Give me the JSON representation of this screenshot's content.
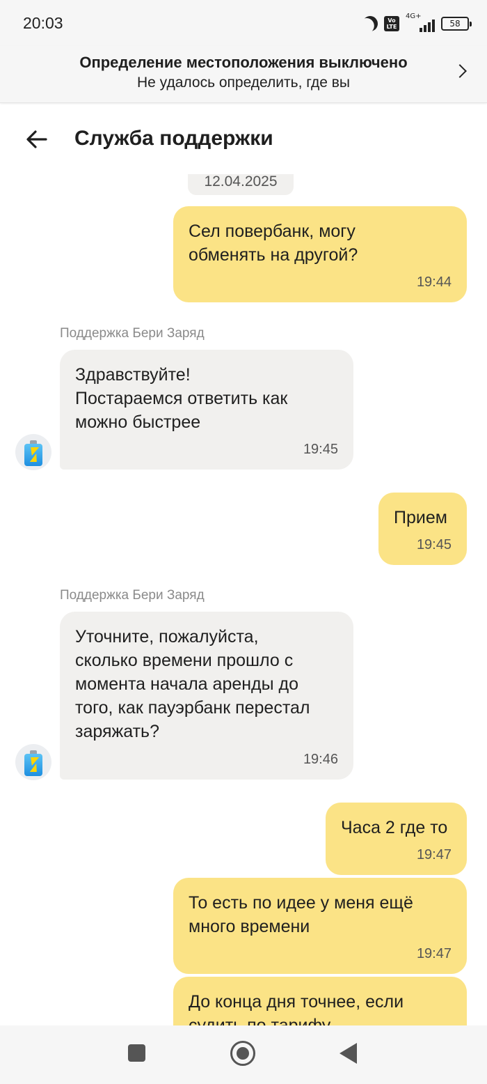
{
  "status_bar": {
    "time": "20:03",
    "volte": "Vo LTE",
    "network": "4G+",
    "battery": "58",
    "icons": [
      "moon-icon",
      "volte-icon",
      "signal-icon",
      "battery-icon"
    ]
  },
  "location_banner": {
    "title": "Определение местоположения выключено",
    "subtitle": "Не удалось определить, где вы"
  },
  "header": {
    "title": "Служба поддержки"
  },
  "chat": {
    "date_label": "12.04.2025",
    "sender_name": "Поддержка Бери Заряд",
    "messages": [
      {
        "direction": "out",
        "text": "Сел повербанк, могу\nобменять на другой?",
        "time": "19:44"
      },
      {
        "direction": "in",
        "text": "Здравствуйте!\nПостараемся ответить как\nможно быстрее",
        "time": "19:45"
      },
      {
        "direction": "out",
        "text": "Прием",
        "time": "19:45"
      },
      {
        "direction": "in",
        "text": "Уточните, пожалуйста,\nсколько времени прошло с\nмомента начала аренды до\nтого, как пауэрбанк перестал\nзаряжать?",
        "time": "19:46"
      },
      {
        "direction": "out",
        "text": "Часа 2 где то",
        "time": "19:47"
      },
      {
        "direction": "out",
        "text": "То есть по идее у меня ещё\nмного времени",
        "time": "19:47"
      },
      {
        "direction": "out",
        "text": "До конца дня точнее, если\nсудить по тарифу",
        "time": ""
      }
    ]
  },
  "colors": {
    "outgoing_bubble": "#fbe386",
    "incoming_bubble": "#f1f0ee",
    "bar_background": "#f6f6f6"
  }
}
